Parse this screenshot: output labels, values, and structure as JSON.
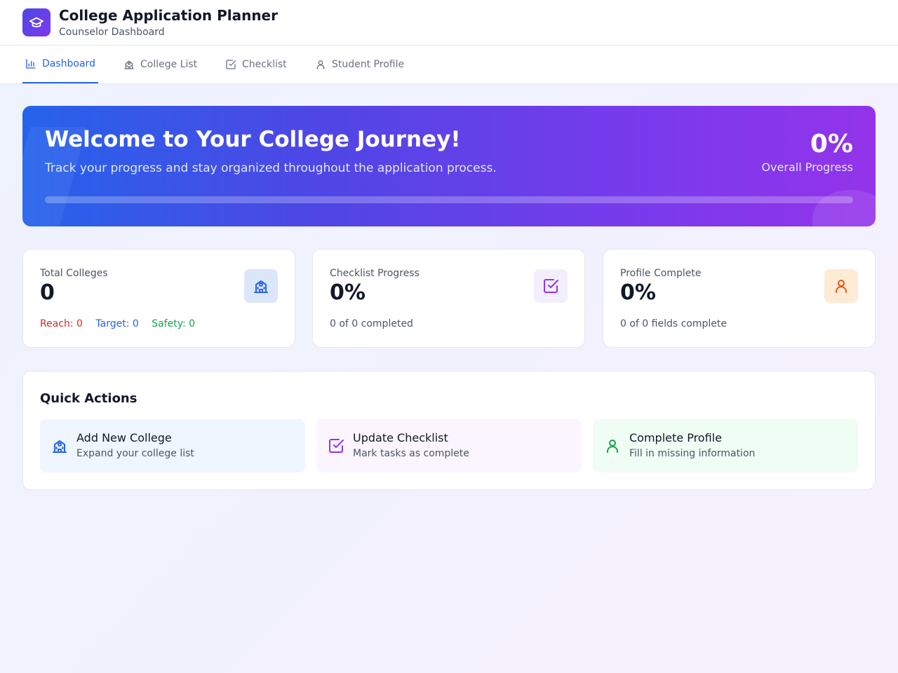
{
  "header": {
    "title": "College Application Planner",
    "subtitle": "Counselor Dashboard",
    "logo_icon": "graduation-cap-icon",
    "brand_gradient": [
      "#4f46e5",
      "#7c3aed"
    ]
  },
  "nav": {
    "tabs": [
      {
        "label": "Dashboard",
        "icon": "bar-chart-icon",
        "active": true
      },
      {
        "label": "College List",
        "icon": "school-icon",
        "active": false
      },
      {
        "label": "Checklist",
        "icon": "check-square-icon",
        "active": false
      },
      {
        "label": "Student Profile",
        "icon": "user-icon",
        "active": false
      }
    ],
    "active_color": "#2563eb"
  },
  "hero": {
    "title": "Welcome to Your College Journey!",
    "text": "Track your progress and stay organized throughout the application process.",
    "progress_value": "0%",
    "progress_label": "Overall Progress",
    "progress_fraction": 0
  },
  "stats": {
    "colleges": {
      "label": "Total Colleges",
      "value": "0",
      "reach": "Reach: 0",
      "target": "Target: 0",
      "safety": "Safety: 0",
      "icon": "school-icon"
    },
    "checklist": {
      "label": "Checklist Progress",
      "value": "0%",
      "footer": "0 of 0 completed",
      "icon": "check-square-icon"
    },
    "profile": {
      "label": "Profile Complete",
      "value": "0%",
      "footer": "0 of 0 fields complete",
      "icon": "user-icon"
    }
  },
  "quick_actions": {
    "title": "Quick Actions",
    "items": [
      {
        "label": "Add New College",
        "description": "Expand your college list",
        "icon": "school-icon"
      },
      {
        "label": "Update Checklist",
        "description": "Mark tasks as complete",
        "icon": "check-square-icon"
      },
      {
        "label": "Complete Profile",
        "description": "Fill in missing information",
        "icon": "user-icon"
      }
    ]
  }
}
